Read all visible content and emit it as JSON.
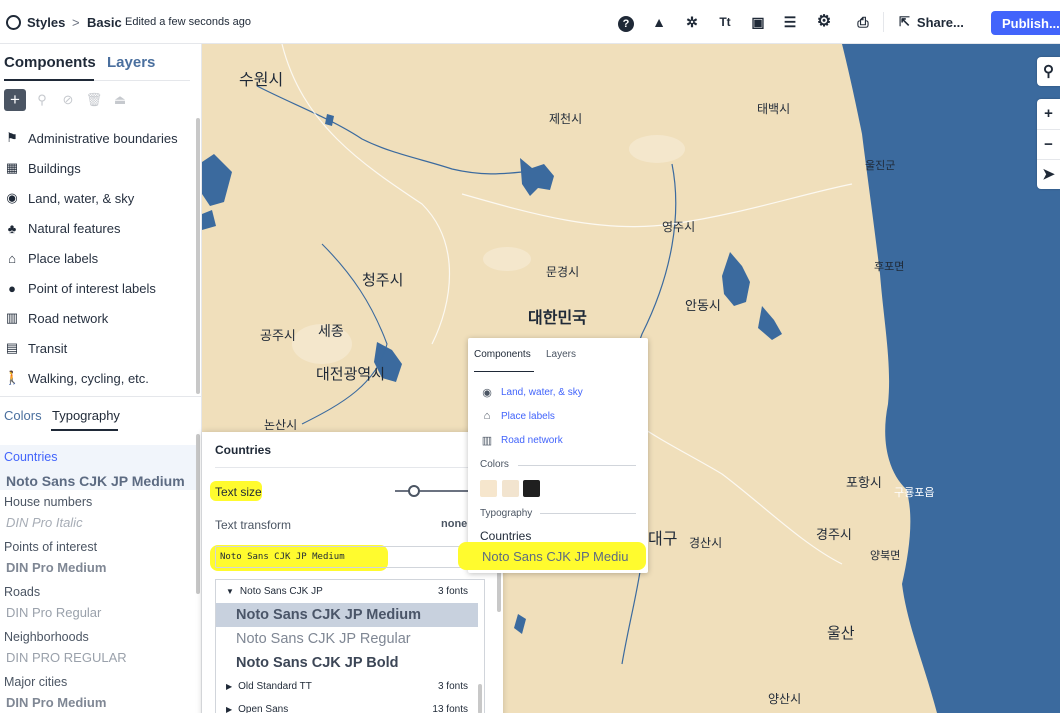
{
  "header": {
    "brand": "Styles",
    "breadcrumb_sep": ">",
    "style_name": "Basic",
    "status": "Edited a few seconds ago",
    "share_label": "Share...",
    "publish_label": "Publish..."
  },
  "sidebar": {
    "tabs": [
      "Components",
      "Layers"
    ],
    "components": [
      {
        "label": "Administrative boundaries",
        "icon": "flag-icon"
      },
      {
        "label": "Buildings",
        "icon": "building-icon"
      },
      {
        "label": "Land, water, & sky",
        "icon": "globe-icon"
      },
      {
        "label": "Natural features",
        "icon": "tree-icon"
      },
      {
        "label": "Place labels",
        "icon": "place-label-icon"
      },
      {
        "label": "Point of interest labels",
        "icon": "poi-pin-icon"
      },
      {
        "label": "Road network",
        "icon": "road-icon"
      },
      {
        "label": "Transit",
        "icon": "transit-icon"
      },
      {
        "label": "Walking, cycling, etc.",
        "icon": "walking-icon"
      }
    ],
    "typo_tabs": [
      "Colors",
      "Typography"
    ],
    "typography": [
      {
        "label": "Countries",
        "font": "Noto Sans CJK JP Medium"
      },
      {
        "label": "House numbers",
        "font": "DIN Pro Italic"
      },
      {
        "label": "Points of interest",
        "font": "DIN Pro Medium"
      },
      {
        "label": "Roads",
        "font": "DIN Pro Regular"
      },
      {
        "label": "Neighborhoods",
        "font": "DIN PRO REGULAR"
      },
      {
        "label": "Major cities",
        "font": "DIN Pro Medium"
      }
    ]
  },
  "panel": {
    "title": "Countries",
    "text_size_label": "Text size",
    "text_transform_label": "Text transform",
    "text_transform_value": "none",
    "font_input_value": "Noto Sans CJK JP Medium",
    "dropdown": {
      "group": "Noto Sans CJK JP",
      "group_count": "3 fonts",
      "fonts": [
        "Noto Sans CJK JP Medium",
        "Noto Sans CJK JP Regular",
        "Noto Sans CJK JP Bold"
      ],
      "other_groups": [
        {
          "name": "Old Standard TT",
          "count": "3 fonts"
        },
        {
          "name": "Open Sans",
          "count": "13 fonts"
        }
      ]
    }
  },
  "popup": {
    "tabs": [
      "Components",
      "Layers"
    ],
    "items": [
      "Land, water, & sky",
      "Place labels",
      "Road network"
    ],
    "colors_label": "Colors",
    "swatch_colors": [
      "#f6e6cd",
      "#f2e4cf",
      "#1f1f1f"
    ],
    "typography_label": "Typography",
    "selected_label": "Countries",
    "selected_font": "Noto Sans CJK JP Mediu"
  },
  "map": {
    "labels": [
      {
        "text": "수원시",
        "key": "suwon"
      },
      {
        "text": "태백시",
        "key": "taebaek"
      },
      {
        "text": "제천시",
        "key": "jecheon"
      },
      {
        "text": "울진군",
        "key": "uljin"
      },
      {
        "text": "영주시",
        "key": "yeongju"
      },
      {
        "text": "후포면",
        "key": "hupo"
      },
      {
        "text": "청주시",
        "key": "cheongju"
      },
      {
        "text": "문경시",
        "key": "mungyeong"
      },
      {
        "text": "대한민국",
        "key": "korea"
      },
      {
        "text": "안동시",
        "key": "andong"
      },
      {
        "text": "공주시",
        "key": "gongju"
      },
      {
        "text": "세종",
        "key": "sejong"
      },
      {
        "text": "대전광역시",
        "key": "daejeon"
      },
      {
        "text": "논산시",
        "key": "nonsan"
      },
      {
        "text": "포항시",
        "key": "pohang"
      },
      {
        "text": "구룡포읍",
        "key": "guryongpo"
      },
      {
        "text": "대구",
        "key": "daegu"
      },
      {
        "text": "경산시",
        "key": "gyeongsan"
      },
      {
        "text": "경주시",
        "key": "gyeongju"
      },
      {
        "text": "양북면",
        "key": "yangbuk"
      },
      {
        "text": "울산",
        "key": "ulsan"
      },
      {
        "text": "양산시",
        "key": "yangsan"
      }
    ],
    "land_color": "#f0dfbb",
    "water_color": "#3b6a9e"
  }
}
